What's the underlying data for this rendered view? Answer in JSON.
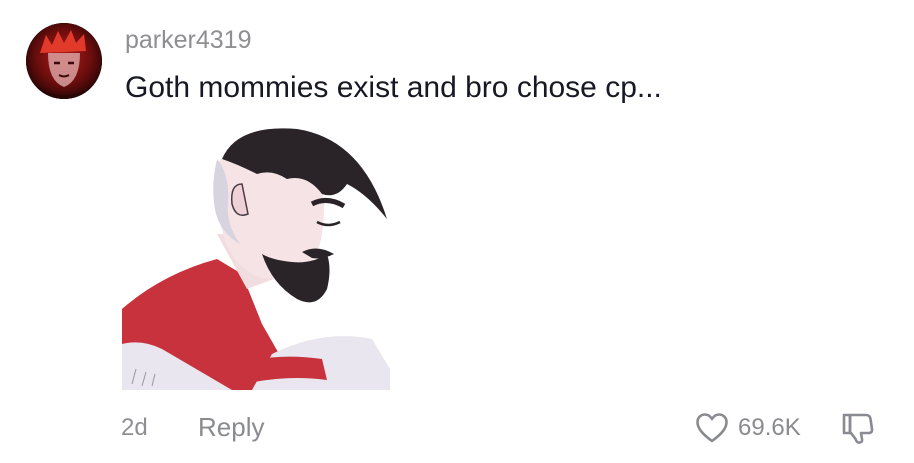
{
  "comment": {
    "avatar_icon": "user-avatar",
    "username": "parker4319",
    "text": "Goth mommies exist and bro chose cp...",
    "sticker_icon": "sad-hero-sticker",
    "timestamp": "2d",
    "reply_label": "Reply",
    "like_icon": "heart-outline-icon",
    "like_count": "69.6K",
    "dislike_icon": "thumbs-down-outline-icon"
  },
  "colors": {
    "text_primary": "#161823",
    "text_secondary": "#8f8f93",
    "background": "#ffffff"
  }
}
